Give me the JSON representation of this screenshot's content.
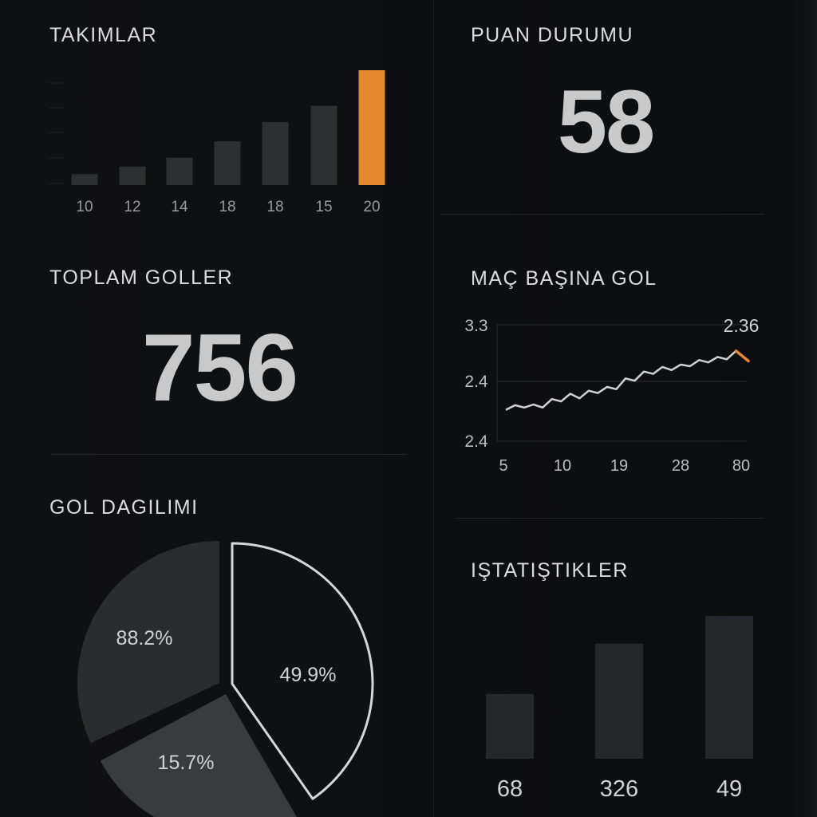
{
  "colors": {
    "background": "#0f1012",
    "bar": "#2e2f33",
    "bar_dark": "#26272a",
    "accent": "#e38a2e",
    "text": "#d9d9d9",
    "pie_dark_slice": "#2b2c30",
    "pie_mid_slice": "#3a3b3f",
    "pie_outline_slice": "#101113"
  },
  "panels": {
    "takimlar": {
      "title": "TAKIMLAR"
    },
    "puan_durumu": {
      "title": "PUAN DURUMU",
      "value": "58"
    },
    "toplam_goller": {
      "title": "TOPLAM GOLLER",
      "value": "756"
    },
    "mac_basina_gol": {
      "title": "MAÇ BAŞINA GOL"
    },
    "gol_dagilimi": {
      "title": "GOL DAGILIMI"
    },
    "istatistikler": {
      "title": "IŞTATIŞTIKLER"
    }
  },
  "chart_data": [
    {
      "id": "takimlar",
      "type": "bar",
      "title": "TAKIMLAR",
      "categories": [
        "10",
        "12",
        "14",
        "18",
        "18",
        "15",
        "20"
      ],
      "values": [
        2,
        3.4,
        5,
        8,
        11.5,
        14.5,
        21
      ],
      "ylim": [
        0,
        21
      ],
      "highlight_index": 6,
      "grid": false
    },
    {
      "id": "mac_basina_gol",
      "type": "line",
      "title": "MAÇ BAŞINA GOL",
      "x_tick_labels": [
        "5",
        "10",
        "19",
        "28",
        "80"
      ],
      "y_tick_labels": [
        "3.3",
        "2.4",
        "2.4"
      ],
      "end_label": "2.36",
      "series": [
        {
          "values": [
            0.17,
            0.23,
            0.2,
            0.24,
            0.2,
            0.31,
            0.28,
            0.38,
            0.32,
            0.42,
            0.39,
            0.47,
            0.44,
            0.58,
            0.55,
            0.67,
            0.64,
            0.73,
            0.69,
            0.76,
            0.74,
            0.82,
            0.79,
            0.86,
            0.83,
            0.94,
            0.87
          ]
        }
      ],
      "grid": true
    },
    {
      "id": "gol_dagilimi",
      "type": "pie",
      "title": "GOL DAGILIMI",
      "slices": [
        {
          "label": "88.2%",
          "value": 88.2
        },
        {
          "label": "15.7%",
          "value": 15.7
        },
        {
          "label": "49.9%",
          "value": 49.9
        }
      ]
    },
    {
      "id": "istatistikler",
      "type": "bar",
      "title": "IŞTATIŞTIKLER",
      "categories": [
        "68",
        "326",
        "49"
      ],
      "values": [
        68,
        121,
        150
      ],
      "ylim": [
        0,
        150
      ]
    }
  ]
}
